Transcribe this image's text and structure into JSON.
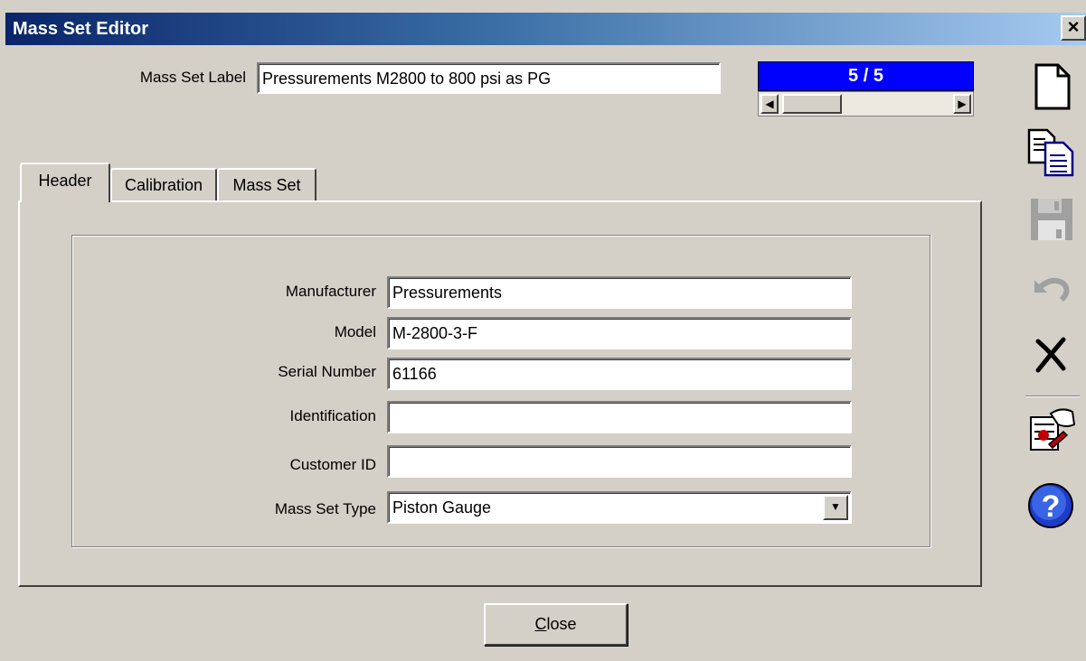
{
  "window": {
    "title": "Mass Set Editor",
    "close_glyph": "✕"
  },
  "label_field": {
    "label": "Mass Set Label",
    "value": "Pressurements M2800 to 800 psi as PG"
  },
  "navigator": {
    "position": "5 / 5"
  },
  "tabs": [
    {
      "label": "Header",
      "active": true
    },
    {
      "label": "Calibration",
      "active": false
    },
    {
      "label": "Mass Set",
      "active": false
    }
  ],
  "header_form": {
    "manufacturer": {
      "label": "Manufacturer",
      "value": "Pressurements"
    },
    "model": {
      "label": "Model",
      "value": "M-2800-3-F"
    },
    "serial_number": {
      "label": "Serial Number",
      "value": "61166"
    },
    "identification": {
      "label": "Identification",
      "value": ""
    },
    "customer_id": {
      "label": "Customer ID",
      "value": ""
    },
    "mass_set_type": {
      "label": "Mass Set Type",
      "value": "Piston Gauge"
    }
  },
  "buttons": {
    "close_accel": "C",
    "close_rest": "lose"
  },
  "toolbar": [
    "new-document-icon",
    "copy-document-icon",
    "save-disk-icon",
    "undo-icon",
    "delete-x-icon",
    "edit-hand-icon",
    "help-icon"
  ],
  "colors": {
    "title_start": "#0a246a",
    "title_end": "#a6caf0",
    "counter_bg": "#0000ff",
    "face": "#d4d0c8"
  }
}
